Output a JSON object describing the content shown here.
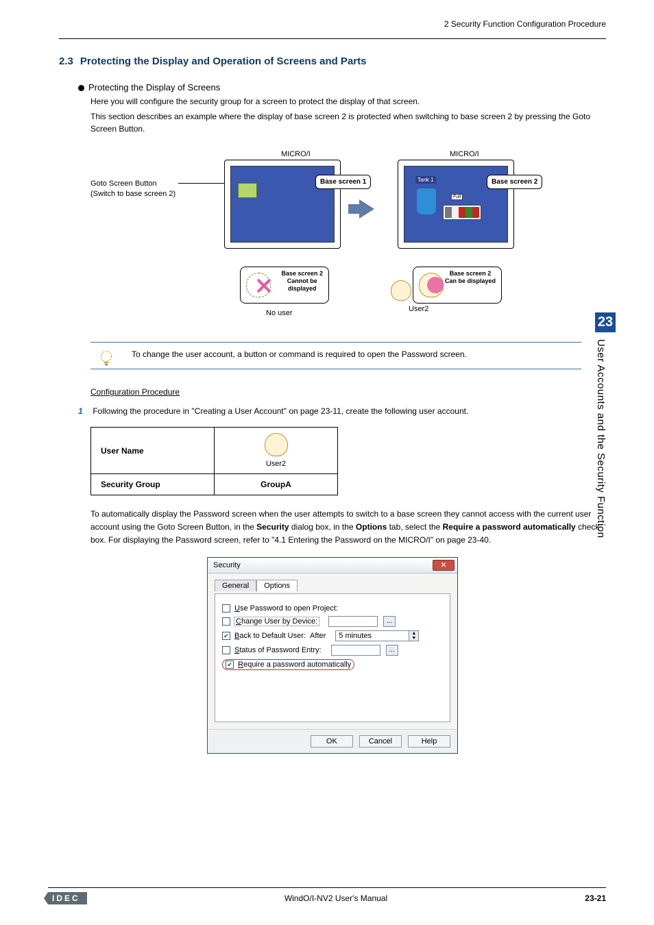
{
  "header": {
    "breadcrumb": "2 Security Function Configuration Procedure"
  },
  "section": {
    "number": "2.3",
    "title": "Protecting the Display and Operation of Screens and Parts",
    "subsection_title": "Protecting the Display of Screens",
    "intro_line1": "Here you will configure the security group for a screen to protect the display of that screen.",
    "intro_line2": "This section describes an example where the display of base screen 2 is protected when switching to base screen 2 by pressing the Goto Screen Button."
  },
  "diagram": {
    "micro_label": "MICRO/I",
    "goto_button_label": "Goto Screen Button",
    "goto_button_sub": "(Switch to base screen 2)",
    "callout_base1": "Base screen 1",
    "callout_base2": "Base screen 2",
    "tank_label": "Tank 1",
    "full_label": "Full",
    "card_left_title": "Base screen 2",
    "card_left_sub1": "Cannot be",
    "card_left_sub2": "displayed",
    "card_right_title": "Base screen 2",
    "card_right_sub": "Can be displayed",
    "no_user_label": "No user",
    "user2_label": "User2"
  },
  "tip": {
    "text": "To change the user account, a button or command is required to open the Password screen."
  },
  "config": {
    "heading": "Configuration Procedure",
    "step1_num": "1",
    "step1_text": "Following the procedure in \"Creating a User Account\" on page 23-11, create the following user account.",
    "table": {
      "row1_label": "User Name",
      "row1_value_caption": "User2",
      "row2_label": "Security Group",
      "row2_value": "GroupA"
    },
    "para2_pre": "To automatically display the Password screen when the user attempts to switch to a base screen they cannot access with the current user account using the Goto Screen Button, in the ",
    "para2_bold1": "Security",
    "para2_mid1": " dialog box, in the ",
    "para2_bold2": "Options",
    "para2_mid2": " tab, select the ",
    "para2_bold3": "Require a password automatically",
    "para2_post": " check box. For displaying the Password screen, refer to \"4.1 Entering the Password on the MICRO/I\" on page 23-40."
  },
  "dialog": {
    "title": "Security",
    "close_glyph": "✕",
    "tab_general": "General",
    "tab_options": "Options",
    "chk_use_password": "Use Password to open Project:",
    "chk_change_user": "Change User by Device:",
    "chk_back_default": "Back to Default User:  After",
    "spin_value": "5 minutes",
    "chk_status_entry": "Status of Password Entry:",
    "chk_require_auto": "Require a password automatically",
    "btn_ok": "OK",
    "btn_cancel": "Cancel",
    "btn_help": "Help",
    "field_btn_label": "..."
  },
  "side": {
    "chapter_number": "23",
    "chapter_title": "User Accounts and the Security Function"
  },
  "footer": {
    "logo": "IDEC",
    "manual": "WindO/I-NV2 User's Manual",
    "page": "23-21"
  }
}
